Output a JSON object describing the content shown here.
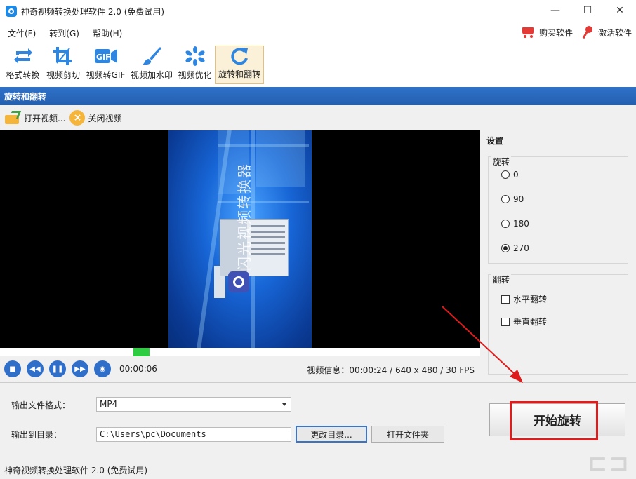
{
  "window": {
    "title": "神奇视频转换处理软件 2.0 (免费试用)"
  },
  "menu": {
    "items": [
      "文件(F)",
      "转到(G)",
      "帮助(H)"
    ],
    "buy": "购买软件",
    "activate": "激活软件"
  },
  "toolbar": {
    "items": [
      {
        "label": "格式转换",
        "icon": "refresh-arrows-icon"
      },
      {
        "label": "视频剪切",
        "icon": "crop-icon"
      },
      {
        "label": "视频转GIF",
        "icon": "gif-icon"
      },
      {
        "label": "视频加水印",
        "icon": "brush-icon"
      },
      {
        "label": "视频优化",
        "icon": "sparkle-icon"
      },
      {
        "label": "旋转和翻转",
        "icon": "rotate-icon"
      }
    ],
    "active_index": 5
  },
  "section": {
    "title": "旋转和翻转"
  },
  "subtoolbar": {
    "open": "打开视频...",
    "close": "关闭视频"
  },
  "video": {
    "overlay_text": "闪光视频转换器",
    "current_time": "00:00:06",
    "info": "视频信息：00:00:24 / 640 x 480 / 30 FPS",
    "progress": 0.295
  },
  "settings": {
    "title": "设置",
    "rotate_group": "旋转",
    "rotate_options": [
      "0",
      "90",
      "180",
      "270"
    ],
    "rotate_selected": "270",
    "flip_group": "翻转",
    "flip_options": [
      "水平翻转",
      "垂直翻转"
    ]
  },
  "output": {
    "format_label": "输出文件格式：",
    "format_value": "MP4",
    "dir_label": "输出到目录：",
    "dir_value": "C:\\Users\\pc\\Documents",
    "change_dir": "更改目录...",
    "open_folder": "打开文件夹",
    "start": "开始旋转"
  },
  "status": {
    "text": "神奇视频转换处理软件 2.0 (免费试用)"
  },
  "colors": {
    "accent": "#2f72c8",
    "highlight": "#e01b1b",
    "progress": "#2ecc40"
  }
}
